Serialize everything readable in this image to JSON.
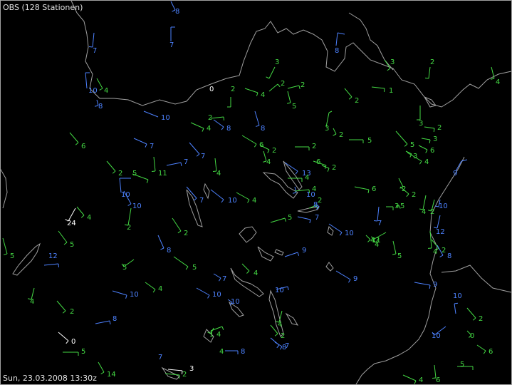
{
  "header": {
    "title": "OBS (128 Stationen)"
  },
  "footer": {
    "timestamp": "Sun, 23.03.2008 13:30z"
  },
  "colors": {
    "background": "#000000",
    "border": "#a0a0a0",
    "text": "#e0e0e0",
    "green": "#44d944",
    "blue": "#4d82ff",
    "white": "#ffffff"
  },
  "stations": [
    {
      "speed": "8",
      "color": "blue"
    },
    {
      "speed": "7",
      "color": "blue"
    },
    {
      "speed": "7",
      "color": "blue"
    },
    {
      "speed": "10",
      "color": "blue"
    },
    {
      "speed": "4",
      "color": "green"
    },
    {
      "speed": "8",
      "color": "blue"
    },
    {
      "speed": "6",
      "color": "green"
    },
    {
      "speed": "3",
      "color": "green"
    },
    {
      "speed": "0",
      "color": "white"
    },
    {
      "speed": "2",
      "color": "green"
    },
    {
      "speed": "4",
      "color": "green"
    },
    {
      "speed": "2",
      "color": "green"
    },
    {
      "speed": "5",
      "color": "green"
    },
    {
      "speed": "8",
      "color": "blue"
    },
    {
      "speed": "3",
      "color": "green"
    },
    {
      "speed": "2",
      "color": "green"
    },
    {
      "speed": "1",
      "color": "green"
    },
    {
      "speed": "2",
      "color": "green"
    },
    {
      "speed": "2",
      "color": "green"
    },
    {
      "speed": "4",
      "color": "green"
    },
    {
      "speed": "10",
      "color": "blue"
    },
    {
      "speed": "2",
      "color": "green"
    },
    {
      "speed": "4",
      "color": "green"
    },
    {
      "speed": "8",
      "color": "blue"
    },
    {
      "speed": "8",
      "color": "blue"
    },
    {
      "speed": "3",
      "color": "green"
    },
    {
      "speed": "2",
      "color": "green"
    },
    {
      "speed": "5",
      "color": "green"
    },
    {
      "speed": "3",
      "color": "green"
    },
    {
      "speed": "2",
      "color": "green"
    },
    {
      "speed": "3",
      "color": "green"
    },
    {
      "speed": "5",
      "color": "green"
    },
    {
      "speed": "6",
      "color": "green"
    },
    {
      "speed": "4",
      "color": "green"
    },
    {
      "speed": "7",
      "color": "blue"
    },
    {
      "speed": "7",
      "color": "blue"
    },
    {
      "speed": "7",
      "color": "blue"
    },
    {
      "speed": "6",
      "color": "green"
    },
    {
      "speed": "2",
      "color": "green"
    },
    {
      "speed": "4",
      "color": "green"
    },
    {
      "speed": "2",
      "color": "green"
    },
    {
      "speed": "6",
      "color": "green"
    },
    {
      "speed": "2",
      "color": "green"
    },
    {
      "speed": "3",
      "color": "green"
    },
    {
      "speed": "9",
      "color": "blue"
    },
    {
      "speed": "2",
      "color": "green"
    },
    {
      "speed": "5",
      "color": "green"
    },
    {
      "speed": "11",
      "color": "green"
    },
    {
      "speed": "4",
      "color": "green"
    },
    {
      "speed": "13",
      "color": "blue"
    },
    {
      "speed": "4",
      "color": "green"
    },
    {
      "speed": "10",
      "color": "blue"
    },
    {
      "speed": "10",
      "color": "blue"
    },
    {
      "speed": "6",
      "color": "green"
    },
    {
      "speed": "2",
      "color": "green"
    },
    {
      "speed": "2",
      "color": "green"
    },
    {
      "speed": "7",
      "color": "blue"
    },
    {
      "speed": "10",
      "color": "blue"
    },
    {
      "speed": "10",
      "color": "blue"
    },
    {
      "speed": "4",
      "color": "green"
    },
    {
      "speed": "4",
      "color": "green"
    },
    {
      "speed": "2",
      "color": "green"
    },
    {
      "speed": "5",
      "color": "green"
    },
    {
      "speed": "7",
      "color": "blue"
    },
    {
      "speed": "4",
      "color": "green"
    },
    {
      "speed": "3",
      "color": "green"
    },
    {
      "speed": "5",
      "color": "green"
    },
    {
      "speed": "4",
      "color": "green"
    },
    {
      "speed": "2",
      "color": "green"
    },
    {
      "speed": "10",
      "color": "blue"
    },
    {
      "speed": "7",
      "color": "blue"
    },
    {
      "speed": "8",
      "color": "blue"
    },
    {
      "speed": "2",
      "color": "green"
    },
    {
      "speed": "2",
      "color": "green"
    },
    {
      "speed": "24",
      "color": "white"
    },
    {
      "speed": "10",
      "color": "blue"
    },
    {
      "speed": "5",
      "color": "green"
    },
    {
      "speed": "5",
      "color": "green"
    },
    {
      "speed": "8",
      "color": "blue"
    },
    {
      "speed": "4",
      "color": "green"
    },
    {
      "speed": "4",
      "color": "green"
    },
    {
      "speed": "12",
      "color": "blue"
    },
    {
      "speed": "4",
      "color": "green"
    },
    {
      "speed": "5",
      "color": "green"
    },
    {
      "speed": "2",
      "color": "green"
    },
    {
      "speed": "8",
      "color": "blue"
    },
    {
      "speed": "11",
      "color": "green"
    },
    {
      "speed": "5",
      "color": "green"
    },
    {
      "speed": "4",
      "color": "green"
    },
    {
      "speed": "7",
      "color": "blue"
    },
    {
      "speed": "9",
      "color": "blue"
    },
    {
      "speed": "10",
      "color": "blue"
    },
    {
      "speed": "10",
      "color": "blue"
    },
    {
      "speed": "9",
      "color": "blue"
    },
    {
      "speed": "9",
      "color": "blue"
    },
    {
      "speed": "4",
      "color": "green"
    },
    {
      "speed": "2",
      "color": "green"
    },
    {
      "speed": "4",
      "color": "green"
    },
    {
      "speed": "5",
      "color": "green"
    },
    {
      "speed": "12",
      "color": "blue"
    },
    {
      "speed": "10",
      "color": "blue"
    },
    {
      "speed": "4",
      "color": "green"
    },
    {
      "speed": "2",
      "color": "green"
    },
    {
      "speed": "8",
      "color": "blue"
    },
    {
      "speed": "8",
      "color": "blue"
    },
    {
      "speed": "10",
      "color": "blue"
    },
    {
      "speed": "10",
      "color": "blue"
    },
    {
      "speed": "10",
      "color": "blue"
    },
    {
      "speed": "0",
      "color": "green"
    },
    {
      "speed": "6",
      "color": "green"
    },
    {
      "speed": "0",
      "color": "white"
    },
    {
      "speed": "5",
      "color": "green"
    },
    {
      "speed": "14",
      "color": "green"
    },
    {
      "speed": "7",
      "color": "blue"
    },
    {
      "speed": "4",
      "color": "green"
    },
    {
      "speed": "8",
      "color": "blue"
    },
    {
      "speed": "3",
      "color": "white"
    },
    {
      "speed": "2",
      "color": "green"
    },
    {
      "speed": "4",
      "color": "green"
    },
    {
      "speed": "6",
      "color": "green"
    },
    {
      "speed": "5",
      "color": "green"
    },
    {
      "speed": "2",
      "color": "green"
    },
    {
      "speed": "1",
      "color": "green"
    },
    {
      "speed": "4",
      "color": "green"
    },
    {
      "speed": "7",
      "color": "blue"
    }
  ]
}
